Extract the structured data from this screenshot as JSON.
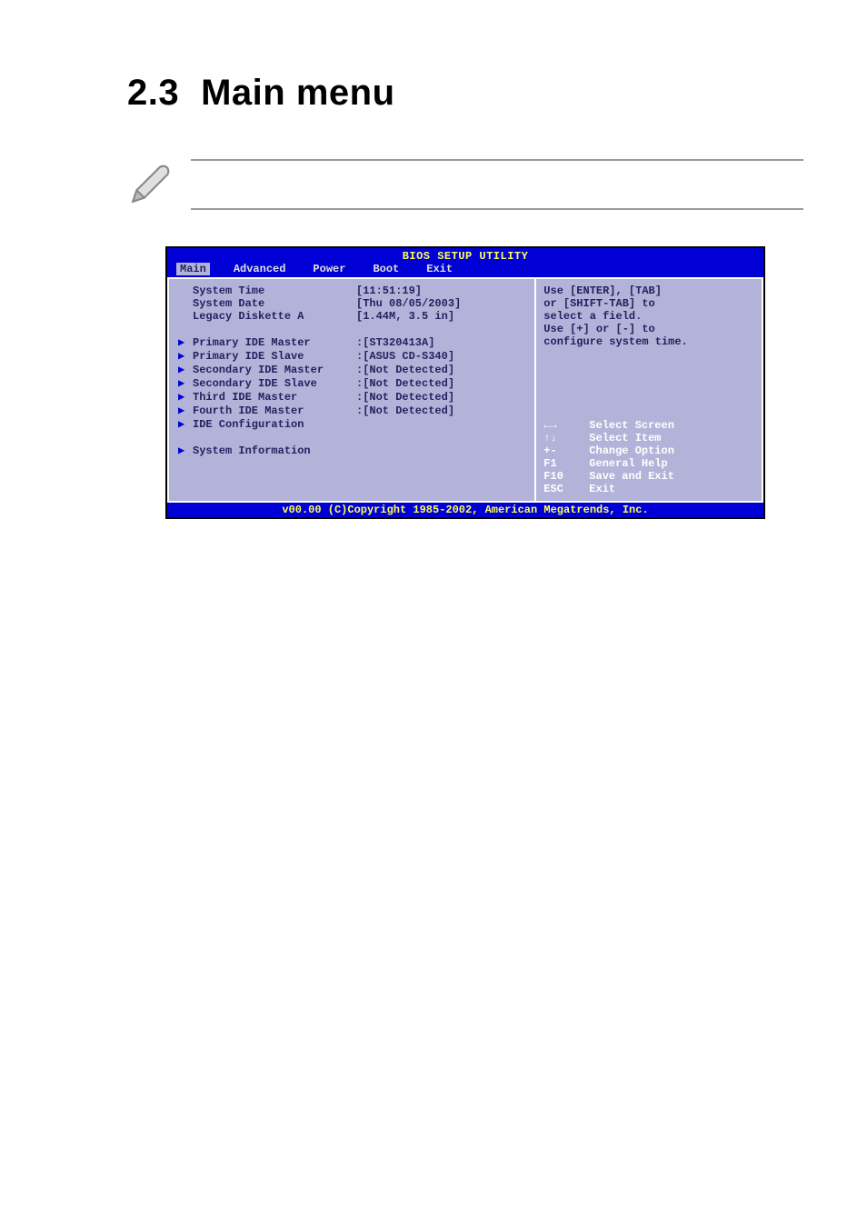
{
  "heading": {
    "number": "2.3",
    "title": "Main menu"
  },
  "bios": {
    "title": "BIOS SETUP UTILITY",
    "tabs": [
      "Main",
      "Advanced",
      "Power",
      "Boot",
      "Exit"
    ],
    "selected_tab": "Main",
    "items": [
      {
        "label": "System Time",
        "value": "[11:51:19]",
        "submenu": false
      },
      {
        "label": "System Date",
        "value": "[Thu 08/05/2003]",
        "submenu": false
      },
      {
        "label": "Legacy Diskette A",
        "value": "[1.44M, 3.5 in]",
        "submenu": false
      }
    ],
    "submenus1": [
      {
        "label": "Primary IDE Master",
        "value": ":[ST320413A]"
      },
      {
        "label": "Primary IDE Slave",
        "value": ":[ASUS CD-S340]"
      },
      {
        "label": "Secondary IDE Master",
        "value": ":[Not Detected]"
      },
      {
        "label": "Secondary IDE Slave",
        "value": ":[Not Detected]"
      },
      {
        "label": "Third IDE Master",
        "value": ":[Not Detected]"
      },
      {
        "label": "Fourth IDE Master",
        "value": ":[Not Detected]"
      },
      {
        "label": "IDE Configuration",
        "value": ""
      }
    ],
    "submenus2": [
      {
        "label": "System Information",
        "value": ""
      }
    ],
    "help": [
      "Use [ENTER], [TAB]",
      "or [SHIFT-TAB] to",
      "select a field.",
      "Use [+] or [-] to",
      "configure system time."
    ],
    "nav": [
      {
        "key": "←→",
        "action": "Select Screen"
      },
      {
        "key": "↑↓",
        "action": "Select Item"
      },
      {
        "key": "+-",
        "action": "Change Option"
      },
      {
        "key": "F1",
        "action": "General Help"
      },
      {
        "key": "F10",
        "action": "Save and Exit"
      },
      {
        "key": "ESC",
        "action": "Exit"
      }
    ],
    "footer": "v00.00 (C)Copyright 1985-2002, American Megatrends, Inc."
  }
}
